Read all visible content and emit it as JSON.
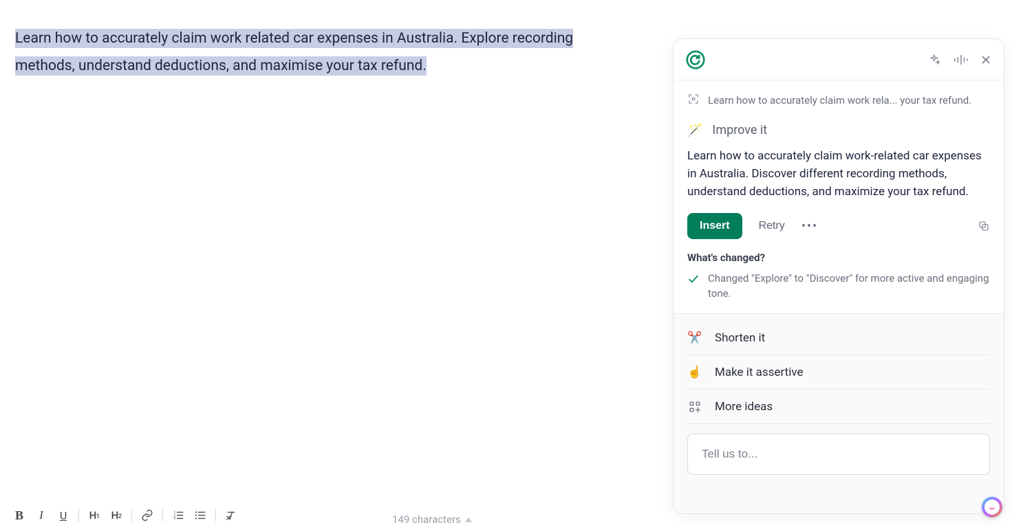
{
  "editor": {
    "selected_text": "Learn how to accurately claim work related car expenses in Australia. Explore recording methods, understand deductions, and maximise your tax refund."
  },
  "toolbar": {
    "char_count_label": "149 characters"
  },
  "panel": {
    "context_summary": "Learn how to accurately claim work rela... your tax refund.",
    "section_title": "Improve it",
    "suggestion": "Learn how to accurately claim work-related car expenses in Australia. Discover different recording methods, understand deductions, and maximize your tax refund.",
    "insert_label": "Insert",
    "retry_label": "Retry",
    "whats_changed_title": "What's changed?",
    "changes": [
      "Changed \"Explore\" to \"Discover\" for more active and engaging tone."
    ],
    "options": {
      "shorten": "Shorten it",
      "assertive": "Make it assertive",
      "more": "More ideas"
    },
    "prompt_placeholder": "Tell us to..."
  }
}
